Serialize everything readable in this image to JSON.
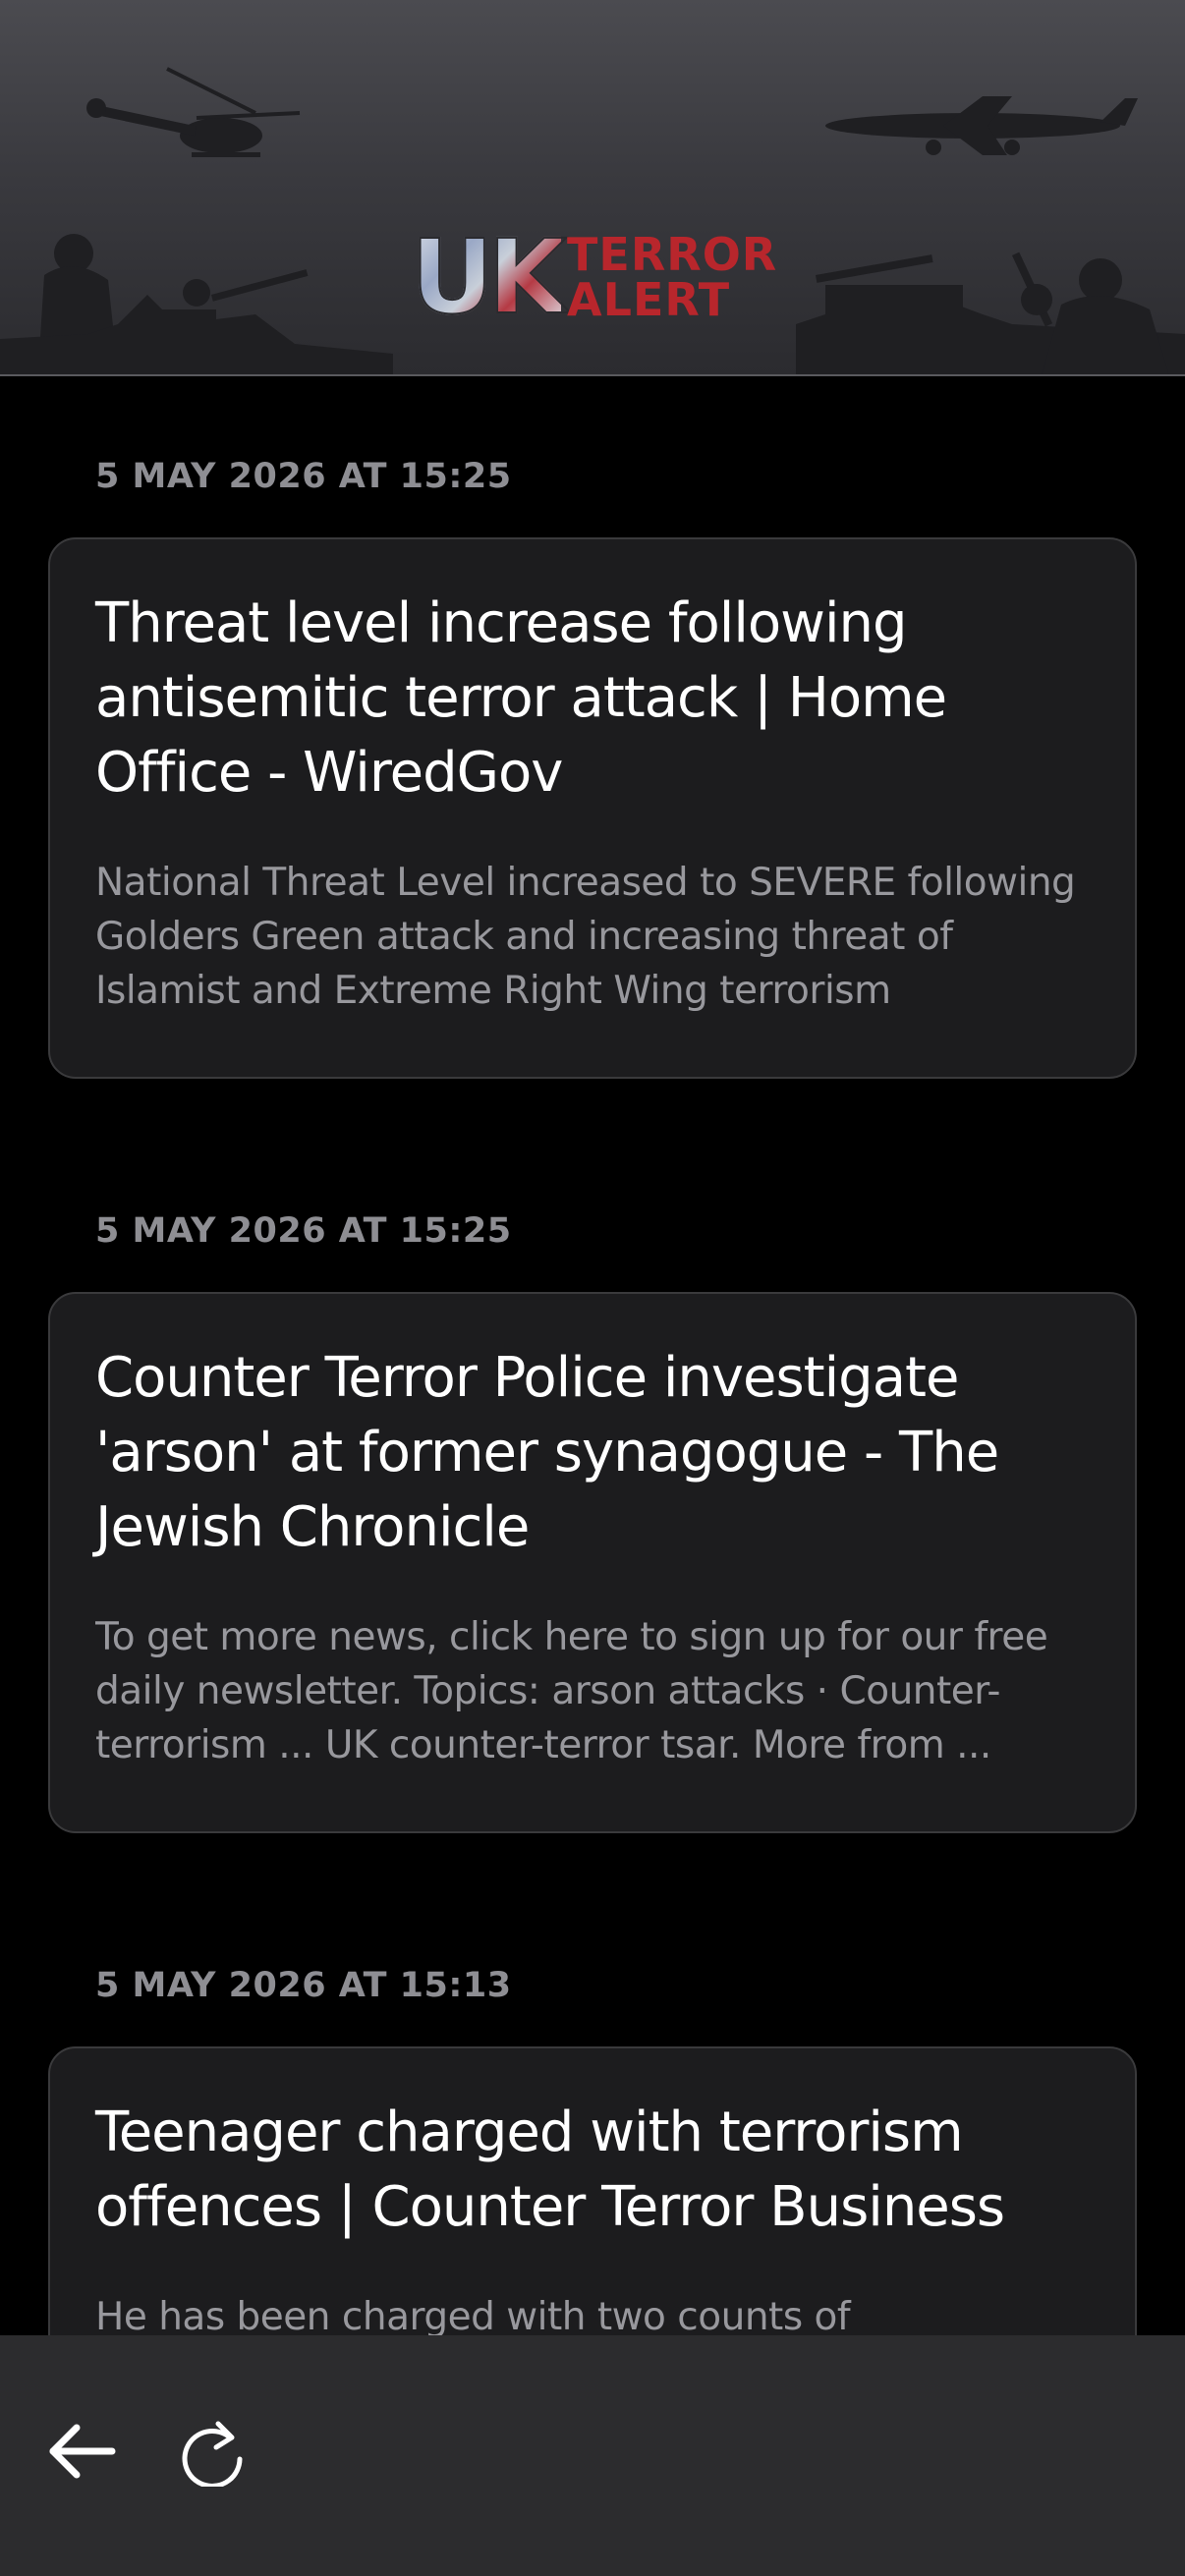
{
  "header": {
    "logo": {
      "uk": "UK",
      "word1": "TERROR",
      "word2": "ALERT"
    }
  },
  "feed": {
    "items": [
      {
        "date": "5 MAY 2026 AT 15:25",
        "title": "Threat level increase following antisemitic terror attack | Home Office - WiredGov",
        "body": "National Threat Level increased to SEVERE following Golders Green attack and increasing threat of Islamist and Extreme Right Wing terrorism"
      },
      {
        "date": "5 MAY 2026 AT 15:25",
        "title": "Counter Terror Police investigate 'arson' at former synagogue - The Jewish Chronicle",
        "body": "To get more news, click here to sign up for our free daily newsletter. Topics: arson attacks  · Counter-terrorism ... UK counter-terror tsar. More from ..."
      },
      {
        "date": "5 MAY 2026 AT 15:13",
        "title": "Teenager charged with terrorism offences | Counter Terror Business",
        "body": "He has been charged with two counts of"
      }
    ]
  },
  "toolbar": {
    "back_icon": "arrow-left-icon",
    "reload_icon": "reload-icon"
  },
  "colors": {
    "background": "#000000",
    "card": "#1c1c1e",
    "card_border": "#3a3a3c",
    "title": "#ffffff",
    "body": "#98989d",
    "date": "#8e8e93",
    "toolbar": "#2c2c2e",
    "logo_red": "#b8262c"
  }
}
